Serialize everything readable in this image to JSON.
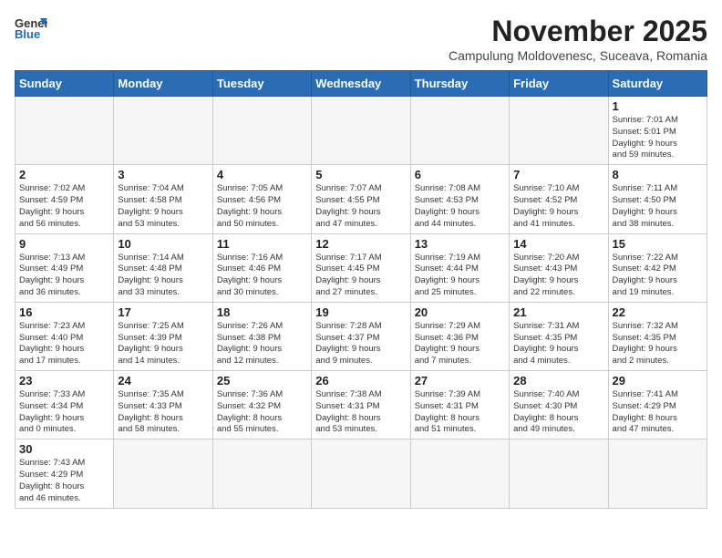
{
  "header": {
    "logo_general": "General",
    "logo_blue": "Blue",
    "month_title": "November 2025",
    "subtitle": "Campulung Moldovenesc, Suceava, Romania"
  },
  "weekdays": [
    "Sunday",
    "Monday",
    "Tuesday",
    "Wednesday",
    "Thursday",
    "Friday",
    "Saturday"
  ],
  "days": {
    "1": {
      "sunrise": "7:01 AM",
      "sunset": "5:01 PM",
      "daylight": "9 hours and 59 minutes."
    },
    "2": {
      "sunrise": "7:02 AM",
      "sunset": "4:59 PM",
      "daylight": "9 hours and 56 minutes."
    },
    "3": {
      "sunrise": "7:04 AM",
      "sunset": "4:58 PM",
      "daylight": "9 hours and 53 minutes."
    },
    "4": {
      "sunrise": "7:05 AM",
      "sunset": "4:56 PM",
      "daylight": "9 hours and 50 minutes."
    },
    "5": {
      "sunrise": "7:07 AM",
      "sunset": "4:55 PM",
      "daylight": "9 hours and 47 minutes."
    },
    "6": {
      "sunrise": "7:08 AM",
      "sunset": "4:53 PM",
      "daylight": "9 hours and 44 minutes."
    },
    "7": {
      "sunrise": "7:10 AM",
      "sunset": "4:52 PM",
      "daylight": "9 hours and 41 minutes."
    },
    "8": {
      "sunrise": "7:11 AM",
      "sunset": "4:50 PM",
      "daylight": "9 hours and 38 minutes."
    },
    "9": {
      "sunrise": "7:13 AM",
      "sunset": "4:49 PM",
      "daylight": "9 hours and 36 minutes."
    },
    "10": {
      "sunrise": "7:14 AM",
      "sunset": "4:48 PM",
      "daylight": "9 hours and 33 minutes."
    },
    "11": {
      "sunrise": "7:16 AM",
      "sunset": "4:46 PM",
      "daylight": "9 hours and 30 minutes."
    },
    "12": {
      "sunrise": "7:17 AM",
      "sunset": "4:45 PM",
      "daylight": "9 hours and 27 minutes."
    },
    "13": {
      "sunrise": "7:19 AM",
      "sunset": "4:44 PM",
      "daylight": "9 hours and 25 minutes."
    },
    "14": {
      "sunrise": "7:20 AM",
      "sunset": "4:43 PM",
      "daylight": "9 hours and 22 minutes."
    },
    "15": {
      "sunrise": "7:22 AM",
      "sunset": "4:42 PM",
      "daylight": "9 hours and 19 minutes."
    },
    "16": {
      "sunrise": "7:23 AM",
      "sunset": "4:40 PM",
      "daylight": "9 hours and 17 minutes."
    },
    "17": {
      "sunrise": "7:25 AM",
      "sunset": "4:39 PM",
      "daylight": "9 hours and 14 minutes."
    },
    "18": {
      "sunrise": "7:26 AM",
      "sunset": "4:38 PM",
      "daylight": "9 hours and 12 minutes."
    },
    "19": {
      "sunrise": "7:28 AM",
      "sunset": "4:37 PM",
      "daylight": "9 hours and 9 minutes."
    },
    "20": {
      "sunrise": "7:29 AM",
      "sunset": "4:36 PM",
      "daylight": "9 hours and 7 minutes."
    },
    "21": {
      "sunrise": "7:31 AM",
      "sunset": "4:35 PM",
      "daylight": "9 hours and 4 minutes."
    },
    "22": {
      "sunrise": "7:32 AM",
      "sunset": "4:35 PM",
      "daylight": "9 hours and 2 minutes."
    },
    "23": {
      "sunrise": "7:33 AM",
      "sunset": "4:34 PM",
      "daylight": "9 hours and 0 minutes."
    },
    "24": {
      "sunrise": "7:35 AM",
      "sunset": "4:33 PM",
      "daylight": "8 hours and 58 minutes."
    },
    "25": {
      "sunrise": "7:36 AM",
      "sunset": "4:32 PM",
      "daylight": "8 hours and 55 minutes."
    },
    "26": {
      "sunrise": "7:38 AM",
      "sunset": "4:31 PM",
      "daylight": "8 hours and 53 minutes."
    },
    "27": {
      "sunrise": "7:39 AM",
      "sunset": "4:31 PM",
      "daylight": "8 hours and 51 minutes."
    },
    "28": {
      "sunrise": "7:40 AM",
      "sunset": "4:30 PM",
      "daylight": "8 hours and 49 minutes."
    },
    "29": {
      "sunrise": "7:41 AM",
      "sunset": "4:29 PM",
      "daylight": "8 hours and 47 minutes."
    },
    "30": {
      "sunrise": "7:43 AM",
      "sunset": "4:29 PM",
      "daylight": "8 hours and 46 minutes."
    }
  },
  "labels": {
    "sunrise": "Sunrise:",
    "sunset": "Sunset:",
    "daylight": "Daylight:"
  }
}
